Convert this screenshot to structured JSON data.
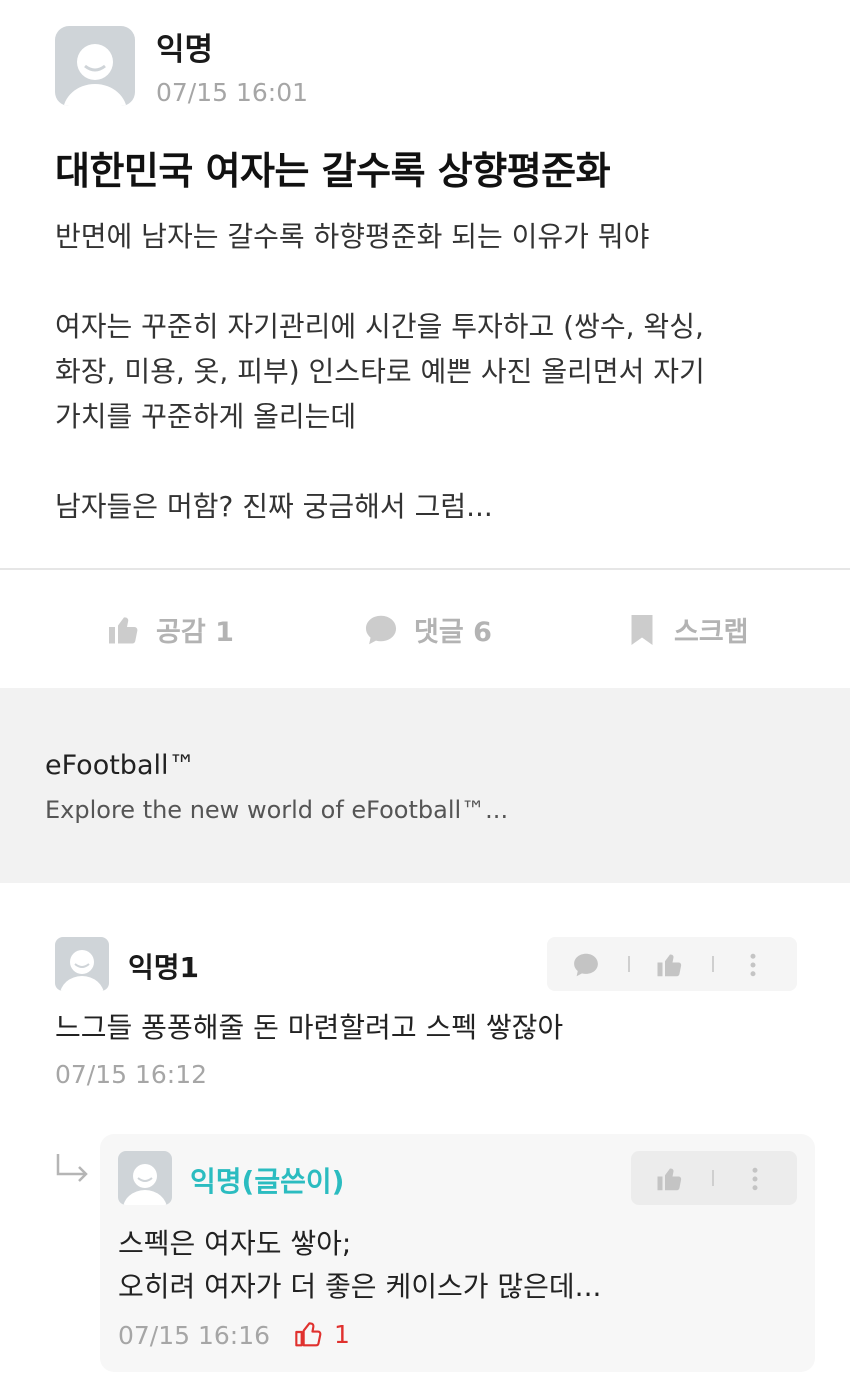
{
  "post": {
    "author": "익명",
    "time": "07/15 16:01",
    "title": "대한민국 여자는 갈수록 상향평준화",
    "body_lines": [
      "반면에 남자는 갈수록 하향평준화 되는 이유가 뭐야",
      "",
      "여자는 꾸준히 자기관리에 시간을 투자하고 (쌍수, 왁싱,",
      "화장, 미용, 옷, 피부) 인스타로 예쁜 사진 올리면서 자기",
      "가치를 꾸준하게 올리는데",
      "",
      "남자들은 머함? 진짜 궁금해서 그럼..."
    ]
  },
  "actions": {
    "like_label": "공감 1",
    "comment_label": "댓글 6",
    "scrap_label": "스크랩"
  },
  "ad": {
    "title": "eFootball™",
    "description": "Explore the new world of eFootball™..."
  },
  "comments": [
    {
      "author": "익명1",
      "text": "느그들 퐁퐁해줄 돈 마련할려고 스펙 쌓잖아",
      "time": "07/15 16:12",
      "reply": {
        "author": "익명(글쓴이)",
        "text_lines": [
          "스펙은 여자도 쌓아;",
          "오히려 여자가 더 좋은 케이스가 많은데..."
        ],
        "time": "07/15 16:16",
        "likes": "1"
      }
    }
  ],
  "colors": {
    "author_op": "#2bbcc0",
    "like_red": "#e0312e",
    "muted": "#a6a6a6"
  },
  "icons": [
    "avatar-icon",
    "thumbs-up-icon",
    "comment-icon",
    "bookmark-icon",
    "more-icon",
    "reply-arrow-icon"
  ]
}
